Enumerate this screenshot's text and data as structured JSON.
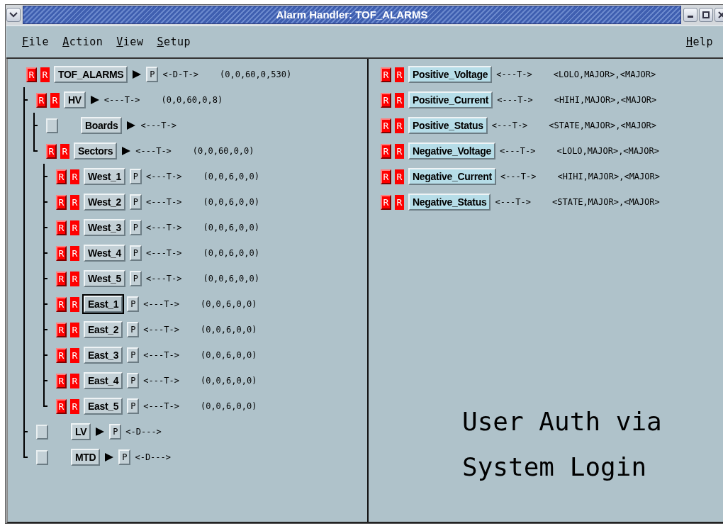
{
  "window": {
    "title": "Alarm Handler: TOF_ALARMS"
  },
  "menu": [
    {
      "label": "File"
    },
    {
      "label": "Action"
    },
    {
      "label": "View"
    },
    {
      "label": "Setup"
    }
  ],
  "help_menu": {
    "label": "Help"
  },
  "tree": {
    "name": "TOF_ALARMS",
    "flags": [
      "R",
      "R"
    ],
    "expandable": true,
    "process": "P",
    "mask": "<-D-T->",
    "counts": "(0,0,60,0,530)",
    "selected": false,
    "children": [
      {
        "name": "HV",
        "flags": [
          "R",
          "R"
        ],
        "expandable": true,
        "mask": "<---T->",
        "counts": "(0,0,60,0,8)",
        "selected": false,
        "children": [
          {
            "name": "Boards",
            "expandable": true,
            "mask": "<---T->",
            "selected": false
          },
          {
            "name": "Sectors",
            "flags": [
              "R",
              "R"
            ],
            "expandable": true,
            "mask": "<---T->",
            "counts": "(0,0,60,0,0)",
            "selected": false,
            "children": [
              {
                "name": "West_1",
                "flags": [
                  "R",
                  "R"
                ],
                "expandable": false,
                "process": "P",
                "mask": "<---T->",
                "counts": "(0,0,6,0,0)",
                "selected": false
              },
              {
                "name": "West_2",
                "flags": [
                  "R",
                  "R"
                ],
                "expandable": false,
                "process": "P",
                "mask": "<---T->",
                "counts": "(0,0,6,0,0)",
                "selected": false
              },
              {
                "name": "West_3",
                "flags": [
                  "R",
                  "R"
                ],
                "expandable": false,
                "process": "P",
                "mask": "<---T->",
                "counts": "(0,0,6,0,0)",
                "selected": false
              },
              {
                "name": "West_4",
                "flags": [
                  "R",
                  "R"
                ],
                "expandable": false,
                "process": "P",
                "mask": "<---T->",
                "counts": "(0,0,6,0,0)",
                "selected": false
              },
              {
                "name": "West_5",
                "flags": [
                  "R",
                  "R"
                ],
                "expandable": false,
                "process": "P",
                "mask": "<---T->",
                "counts": "(0,0,6,0,0)",
                "selected": false
              },
              {
                "name": "East_1",
                "flags": [
                  "R",
                  "R"
                ],
                "expandable": false,
                "process": "P",
                "mask": "<---T->",
                "counts": "(0,0,6,0,0)",
                "selected": true
              },
              {
                "name": "East_2",
                "flags": [
                  "R",
                  "R"
                ],
                "expandable": false,
                "process": "P",
                "mask": "<---T->",
                "counts": "(0,0,6,0,0)",
                "selected": false
              },
              {
                "name": "East_3",
                "flags": [
                  "R",
                  "R"
                ],
                "expandable": false,
                "process": "P",
                "mask": "<---T->",
                "counts": "(0,0,6,0,0)",
                "selected": false
              },
              {
                "name": "East_4",
                "flags": [
                  "R",
                  "R"
                ],
                "expandable": false,
                "process": "P",
                "mask": "<---T->",
                "counts": "(0,0,6,0,0)",
                "selected": false
              },
              {
                "name": "East_5",
                "flags": [
                  "R",
                  "R"
                ],
                "expandable": false,
                "process": "P",
                "mask": "<---T->",
                "counts": "(0,0,6,0,0)",
                "selected": false
              }
            ]
          }
        ]
      },
      {
        "name": "LV",
        "expandable": true,
        "process": "P",
        "mask": "<-D--->",
        "selected": false
      },
      {
        "name": "MTD",
        "expandable": true,
        "process": "P",
        "mask": "<-D--->",
        "selected": false
      }
    ]
  },
  "channels": [
    {
      "flags": [
        "R",
        "R"
      ],
      "name": "Positive_Voltage",
      "mask": "<---T->",
      "severity": "<LOLO,MAJOR>,<MAJOR>"
    },
    {
      "flags": [
        "R",
        "R"
      ],
      "name": "Positive_Current",
      "mask": "<---T->",
      "severity": "<HIHI,MAJOR>,<MAJOR>"
    },
    {
      "flags": [
        "R",
        "R"
      ],
      "name": "Positive_Status",
      "mask": "<---T->",
      "severity": "<STATE,MAJOR>,<MAJOR>"
    },
    {
      "flags": [
        "R",
        "R"
      ],
      "name": "Negative_Voltage",
      "mask": "<---T->",
      "severity": "<LOLO,MAJOR>,<MAJOR>"
    },
    {
      "flags": [
        "R",
        "R"
      ],
      "name": "Negative_Current",
      "mask": "<---T->",
      "severity": "<HIHI,MAJOR>,<MAJOR>"
    },
    {
      "flags": [
        "R",
        "R"
      ],
      "name": "Negative_Status",
      "mask": "<---T->",
      "severity": "<STATE,MAJOR>,<MAJOR>"
    }
  ],
  "annotation": [
    "User Auth via",
    "System Login"
  ]
}
